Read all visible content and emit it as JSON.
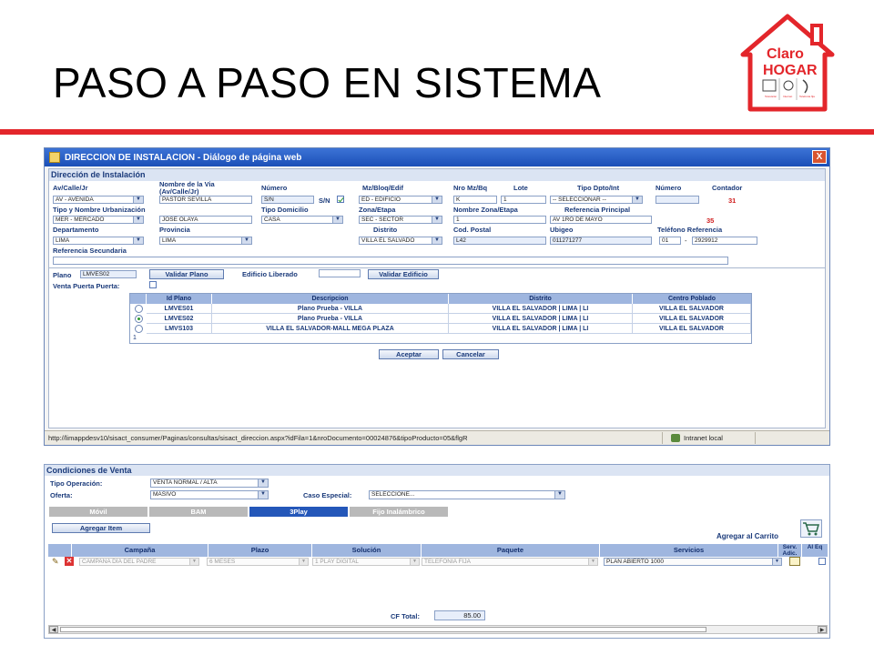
{
  "slide": {
    "title": "PASO A PASO EN SISTEMA",
    "logo": {
      "line1": "Claro",
      "line2": "HOGAR",
      "icons": [
        "Televisión",
        "Internet",
        "Telefonía fija"
      ]
    },
    "accent_color": "#e3262b"
  },
  "dialog": {
    "title": "DIRECCION DE INSTALACION - Diálogo de página web",
    "close": "X",
    "section": "Dirección de Instalación",
    "labels": {
      "av_calle": "Av/Calle/Jr",
      "nombre_via": "Nombre de la Via",
      "nombre_via2": "(Av/Calle/Jr)",
      "numero": "Número",
      "mz_bloq": "Mz/Bloq/Edif",
      "nro_mz": "Nro Mz/Bq",
      "lote": "Lote",
      "tipo_dpto": "Tipo Dpto/Int",
      "numero2": "Número",
      "contador": "Contador",
      "tipo_urb": "Tipo y Nombre Urbanización",
      "tipo_domicilio": "Tipo Domicilio",
      "zona_etapa": "Zona/Etapa",
      "nombre_zona": "Nombre Zona/Etapa",
      "ref_principal": "Referencia Principal",
      "departamento": "Departamento",
      "provincia": "Provincia",
      "distrito": "Distrito",
      "cod_postal": "Cod. Postal",
      "ubigeo": "Ubigeo",
      "telefono_ref": "Teléfono Referencia",
      "ref_secundaria": "Referencia Secundaria",
      "plano": "Plano",
      "edificio_liberado": "Edificio Liberado",
      "venta_puerta": "Venta Puerta Puerta:",
      "sn": "S/N"
    },
    "values": {
      "av_calle": "AV - AVENIDA",
      "nombre_via": "PASTOR SEVILLA",
      "numero": "S/N",
      "mz_bloq": "ED - EDIFICIO",
      "nro_mz": "K",
      "lote": "1",
      "tipo_dpto": "-- SELECCIONAR --",
      "numero2": "",
      "contador1": "31",
      "tipo_urb": "MER - MERCADO",
      "nombre_urb": "JOSE OLAYA",
      "tipo_domicilio": "CASA",
      "zona_etapa": "SEC - SECTOR",
      "nombre_zona": "1",
      "ref_principal": "AV 1RO DE MAYO",
      "contador2": "35",
      "departamento": "LIMA",
      "provincia": "LIMA",
      "distrito": "VILLA EL SALVADO",
      "cod_postal": "L42",
      "ubigeo": "011271277",
      "tel_prefijo": "01",
      "tel_sep": "-",
      "tel_numero": "2929912",
      "ref_secundaria": "",
      "plano": "LMVES02",
      "edificio_liberado": ""
    },
    "buttons": {
      "validar_plano": "Validar Plano",
      "validar_edificio": "Validar Edificio",
      "aceptar": "Aceptar",
      "cancelar": "Cancelar"
    },
    "table": {
      "headers": [
        "Id Plano",
        "Descripcion",
        "Distrito",
        "Centro Poblado"
      ],
      "rows": [
        {
          "id": "LMVES01",
          "desc": "Plano Prueba - VILLA",
          "distrito": "VILLA EL SALVADOR | LIMA | LI",
          "centro": "VILLA EL SALVADOR",
          "selected": false
        },
        {
          "id": "LMVES02",
          "desc": "Plano Prueba - VILLA",
          "distrito": "VILLA EL SALVADOR | LIMA | LI",
          "centro": "VILLA EL SALVADOR",
          "selected": true
        },
        {
          "id": "LMVS103",
          "desc": "VILLA EL SALVADOR-MALL MEGA PLAZA",
          "distrito": "VILLA EL SALVADOR | LIMA | LI",
          "centro": "VILLA EL SALVADOR",
          "selected": false
        }
      ],
      "footer": "1"
    },
    "status": {
      "url": "http://limappdesv10/sisact_consumer/Paginas/consultas/sisact_direccion.aspx?idFila=1&nroDocumento=00024876&tipoProducto=05&flgR",
      "zone": "Intranet local"
    }
  },
  "conditions": {
    "section": "Condiciones de Venta",
    "tipo_operacion_label": "Tipo Operación:",
    "tipo_operacion": "VENTA NORMAL / ALTA",
    "oferta_label": "Oferta:",
    "oferta": "MASIVO",
    "caso_especial_label": "Caso Especial:",
    "caso_especial": "SELECCIONE...",
    "tabs": [
      "Móvil",
      "BAM",
      "3Play",
      "Fijo Inalámbrico"
    ],
    "active_tab": "3Play",
    "agregar_item": "Agregar Item",
    "agregar_carrito": "Agregar al Carrito",
    "grid_headers": [
      "Campaña",
      "Plazo",
      "Solución",
      "Paquete",
      "Servicios",
      "Serv. Adic.",
      "Al Eq"
    ],
    "row": {
      "campana": "CAMPAÑA DÍA DEL PADRE",
      "plazo": "6 MESES",
      "solucion": "1 PLAY DIGITAL",
      "paquete": "TELEFONIA FIJA",
      "servicios": "PLAN ABIERTO 1000"
    },
    "cf_total_label": "CF Total:",
    "cf_total": "85.00"
  }
}
